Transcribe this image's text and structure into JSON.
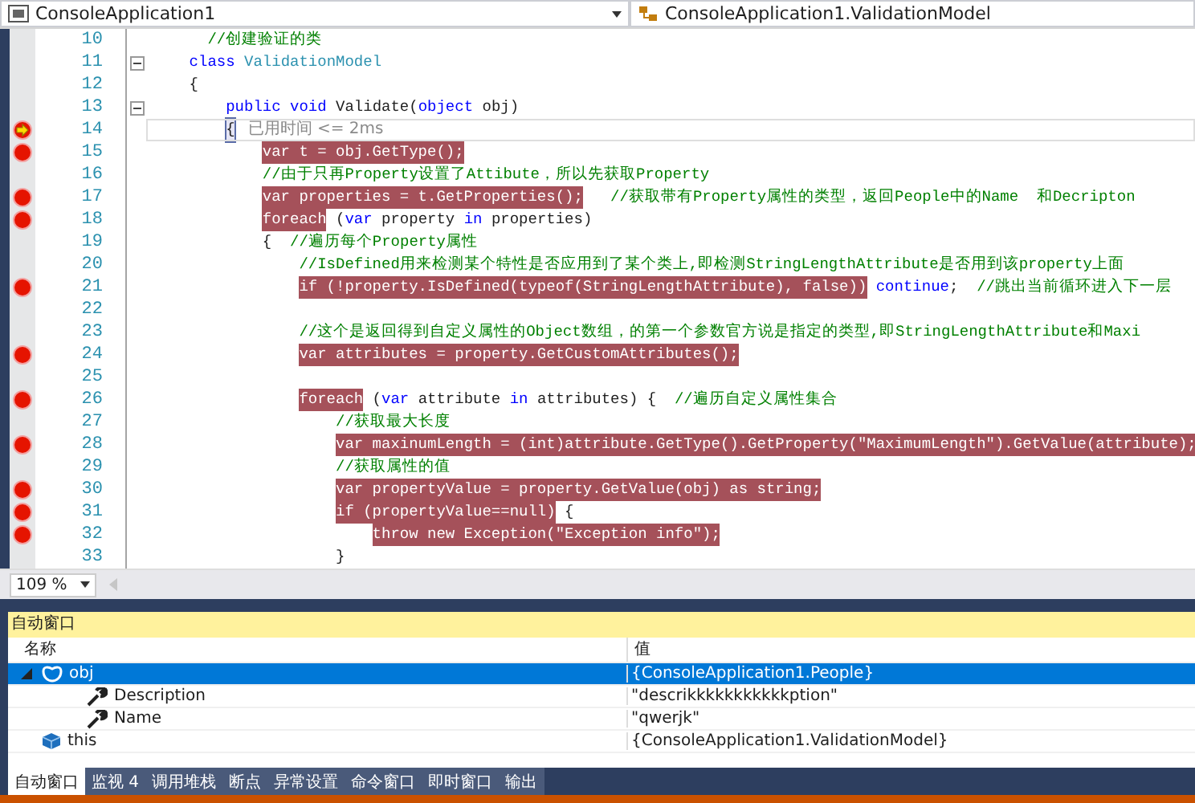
{
  "navigation_bar": {
    "project": "ConsoleApplication1",
    "type": "ConsoleApplication1.ValidationModel"
  },
  "code_lines": [
    {
      "number": "10",
      "breakpoint": false,
      "segments": [
        {
          "kind": "comment",
          "text": "  //创建验证的类"
        }
      ]
    },
    {
      "number": "11",
      "breakpoint": false,
      "fold": true,
      "segments": [
        {
          "kind": "keyword",
          "text": "class"
        },
        {
          "kind": "type",
          "text": " ValidationModel"
        }
      ]
    },
    {
      "number": "12",
      "breakpoint": false,
      "segments": [
        {
          "kind": "plain",
          "text": "{"
        }
      ],
      "children": [
        {
          "number": "13",
          "breakpoint": false,
          "fold": true,
          "segments": [
            {
              "kind": "keyword",
              "text": "public void"
            },
            {
              "kind": "plain",
              "text": " Validate("
            },
            {
              "kind": "keyword",
              "text": "object"
            },
            {
              "kind": "plain",
              "text": " obj)"
            }
          ]
        },
        {
          "number": "14",
          "breakpoint": true,
          "current": true,
          "segments": [
            {
              "kind": "brace",
              "text": "{"
            },
            {
              "kind": "tip",
              "text": "已用时间 <= 2ms"
            }
          ],
          "children": [
            {
              "number": "15",
              "breakpoint": true,
              "segments": [
                {
                  "kind": "highlight",
                  "text": "var t = obj.GetType();"
                }
              ]
            },
            {
              "number": "16",
              "breakpoint": false,
              "segments": [
                {
                  "kind": "comment",
                  "text": "//由于只再Property设置了Attibute，所以先获取Property"
                }
              ]
            },
            {
              "number": "17",
              "breakpoint": true,
              "segments": [
                {
                  "kind": "highlight",
                  "text": "var properties = t.GetProperties();"
                },
                {
                  "kind": "comment",
                  "text": "   //获取带有Property属性的类型，返回People中的Name  和Decripton"
                }
              ]
            },
            {
              "number": "18",
              "breakpoint": true,
              "segments": [
                {
                  "kind": "highlight",
                  "text": "foreach"
                },
                {
                  "kind": "plain",
                  "text": " ("
                },
                {
                  "kind": "keyword",
                  "text": "var"
                },
                {
                  "kind": "plain",
                  "text": " property "
                },
                {
                  "kind": "keyword",
                  "text": "in"
                },
                {
                  "kind": "plain",
                  "text": " properties)"
                }
              ]
            },
            {
              "number": "19",
              "breakpoint": false,
              "segments": [
                {
                  "kind": "plain",
                  "text": "{"
                },
                {
                  "kind": "comment",
                  "text": "  //遍历每个Property属性"
                }
              ],
              "children": [
                {
                  "number": "20",
                  "breakpoint": false,
                  "segments": [
                    {
                      "kind": "comment",
                      "text": "//IsDefined用来检测某个特性是否应用到了某个类上,即检测StringLengthAttribute是否用到该property上面"
                    }
                  ]
                },
                {
                  "number": "21",
                  "breakpoint": true,
                  "segments": [
                    {
                      "kind": "highlight",
                      "text": "if (!property.IsDefined(typeof(StringLengthAttribute), false))"
                    },
                    {
                      "kind": "keyword",
                      "text": " continue"
                    },
                    {
                      "kind": "plain",
                      "text": ";"
                    },
                    {
                      "kind": "comment",
                      "text": "  //跳出当前循环进入下一层"
                    }
                  ]
                },
                {
                  "number": "22",
                  "breakpoint": false
                },
                {
                  "number": "23",
                  "breakpoint": false,
                  "segments": [
                    {
                      "kind": "comment",
                      "text": "//这个是返回得到自定义属性的Object数组，的第一个参数官方说是指定的类型,即StringLengthAttribute和Maxi"
                    }
                  ]
                },
                {
                  "number": "24",
                  "breakpoint": true,
                  "segments": [
                    {
                      "kind": "highlight",
                      "text": "var attributes = property.GetCustomAttributes();"
                    }
                  ]
                },
                {
                  "number": "25",
                  "breakpoint": false
                },
                {
                  "number": "26",
                  "breakpoint": true,
                  "segments": [
                    {
                      "kind": "highlight",
                      "text": "foreach"
                    },
                    {
                      "kind": "plain",
                      "text": " ("
                    },
                    {
                      "kind": "keyword",
                      "text": "var"
                    },
                    {
                      "kind": "plain",
                      "text": " attribute "
                    },
                    {
                      "kind": "keyword",
                      "text": "in"
                    },
                    {
                      "kind": "plain",
                      "text": " attributes) {"
                    },
                    {
                      "kind": "comment",
                      "text": "  //遍历自定义属性集合"
                    }
                  ],
                  "children": [
                    {
                      "number": "27",
                      "breakpoint": false,
                      "segments": [
                        {
                          "kind": "comment",
                          "text": "//获取最大长度"
                        }
                      ]
                    },
                    {
                      "number": "28",
                      "breakpoint": true,
                      "segments": [
                        {
                          "kind": "highlight",
                          "text": "var maxinumLength = (int)attribute.GetType().GetProperty(\"MaximumLength\").GetValue(attribute);"
                        }
                      ]
                    },
                    {
                      "number": "29",
                      "breakpoint": false,
                      "segments": [
                        {
                          "kind": "comment",
                          "text": "//获取属性的值"
                        }
                      ]
                    },
                    {
                      "number": "30",
                      "breakpoint": true,
                      "segments": [
                        {
                          "kind": "highlight",
                          "text": "var propertyValue = property.GetValue(obj) as string;"
                        }
                      ]
                    },
                    {
                      "number": "31",
                      "breakpoint": true,
                      "segments": [
                        {
                          "kind": "highlight",
                          "text": "if (propertyValue==null)"
                        },
                        {
                          "kind": "plain",
                          "text": " {"
                        }
                      ],
                      "children": [
                        {
                          "number": "32",
                          "breakpoint": true,
                          "segments": [
                            {
                              "kind": "highlight",
                              "text": "throw new Exception(\"Exception info\");"
                            }
                          ]
                        }
                      ]
                    },
                    {
                      "number": "33",
                      "breakpoint": false,
                      "segments": [
                        {
                          "kind": "plain",
                          "text": "}"
                        }
                      ]
                    }
                  ]
                }
              ]
            }
          ]
        }
      ]
    }
  ],
  "zoom": "109 %",
  "autos_window": {
    "title": "自动窗口",
    "columns": [
      "名称",
      "值"
    ],
    "rows": [
      {
        "name": "obj",
        "value": "{ConsoleApplication1.People}",
        "kind": "object",
        "selected": true,
        "expanded": true,
        "children": [
          {
            "name": "Description",
            "value": "\"descrikkkkkkkkkkkption\"",
            "kind": "property",
            "selected": false
          },
          {
            "name": "Name",
            "value": "\"qwerjk\"",
            "kind": "property",
            "selected": false
          }
        ]
      },
      {
        "name": "this",
        "value": "{ConsoleApplication1.ValidationModel}",
        "kind": "class",
        "selected": false
      }
    ]
  },
  "bottom_tabs": [
    {
      "label": "自动窗口",
      "selected": true
    },
    {
      "label": "监视 4",
      "selected": false
    },
    {
      "label": "调用堆栈",
      "selected": false
    },
    {
      "label": "断点",
      "selected": false
    },
    {
      "label": "异常设置",
      "selected": false
    },
    {
      "label": "命令窗口",
      "selected": false
    },
    {
      "label": "即时窗口",
      "selected": false
    },
    {
      "label": "输出",
      "selected": false
    }
  ]
}
